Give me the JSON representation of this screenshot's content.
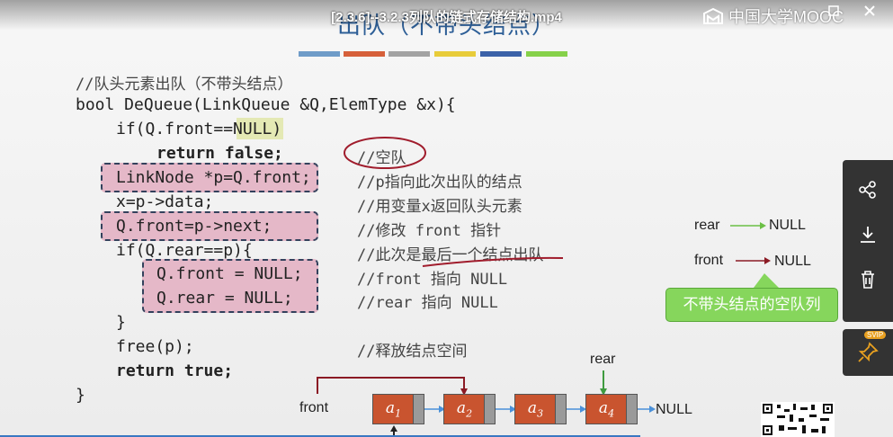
{
  "video_title": "[2.3.6]--3.2.3列队的链式存储结构.mp4",
  "logo_text": "中国大学MOOC",
  "slide_title": "出队（不带头结点）",
  "color_bars": [
    "#6f9cc8",
    "#d6603a",
    "#a3a3a3",
    "#e8cc3a",
    "#3b62a8",
    "#86d14a"
  ],
  "code_lines": {
    "l0": "//队头元素出队（不带头结点）",
    "l1": "bool DeQueue(LinkQueue &Q,ElemType &x){",
    "l2": "if(Q.front==NULL)",
    "l3": "return false;",
    "l4": "LinkNode *p=Q.front;",
    "l5": "x=p->data;",
    "l6": "Q.front=p->next;",
    "l7": "if(Q.rear==p){",
    "l8": "Q.front = NULL;",
    "l9": "Q.rear = NULL;",
    "l10": "}",
    "l11": "free(p);",
    "l12": "return true;",
    "l13": "}"
  },
  "comments": {
    "c3": "//空队",
    "c4": "//p指向此次出队的结点",
    "c5": "//用变量x返回队头元素",
    "c6": "//修改 front 指针",
    "c7": "//此次是最后一个结点出队",
    "c8": "//front 指向 NULL",
    "c9": "//rear 指向 NULL",
    "c11": "//释放结点空间"
  },
  "empty_queue": {
    "rear_label": "rear",
    "front_label": "front",
    "rear_null": "NULL",
    "front_null": "NULL",
    "callout": "不带头结点的空队列"
  },
  "linked_list": {
    "front_label": "front",
    "rear_label": "rear",
    "nodes": [
      "a1",
      "a2",
      "a3",
      "a4"
    ],
    "tail_null": "NULL"
  },
  "sidebar": {
    "svip_badge": "SVIP"
  },
  "colors": {
    "accent": "#2e5f97",
    "node": "#c9542f",
    "callout": "#86d65c",
    "highlight": "#e5b8c8"
  }
}
